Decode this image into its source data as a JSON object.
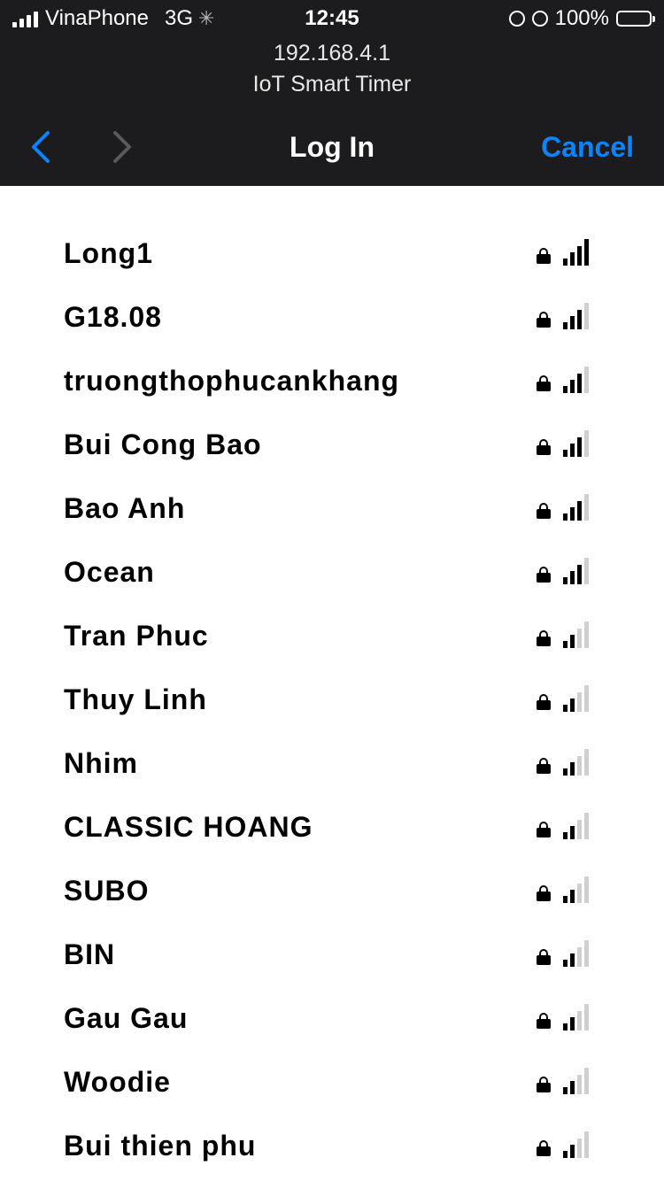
{
  "status_bar": {
    "carrier": "VinaPhone",
    "network": "3G",
    "time": "12:45",
    "battery": "100%",
    "battery_color": "#ffd60a"
  },
  "header": {
    "url": "192.168.4.1",
    "page_title": "IoT Smart Timer",
    "title": "Log In",
    "cancel_label": "Cancel",
    "accent_color": "#0a84ff"
  },
  "networks": [
    {
      "ssid": "Long1",
      "secured": true,
      "signal": 4
    },
    {
      "ssid": "G18.08",
      "secured": true,
      "signal": 3
    },
    {
      "ssid": "truongthophucankhang",
      "secured": true,
      "signal": 3
    },
    {
      "ssid": "Bui Cong Bao",
      "secured": true,
      "signal": 3
    },
    {
      "ssid": "Bao Anh",
      "secured": true,
      "signal": 3
    },
    {
      "ssid": "Ocean",
      "secured": true,
      "signal": 3
    },
    {
      "ssid": "Tran Phuc",
      "secured": true,
      "signal": 2
    },
    {
      "ssid": "Thuy Linh",
      "secured": true,
      "signal": 2
    },
    {
      "ssid": "Nhim",
      "secured": true,
      "signal": 2
    },
    {
      "ssid": "CLASSIC HOANG",
      "secured": true,
      "signal": 2
    },
    {
      "ssid": "SUBO",
      "secured": true,
      "signal": 2
    },
    {
      "ssid": "BIN",
      "secured": true,
      "signal": 2
    },
    {
      "ssid": "Gau Gau",
      "secured": true,
      "signal": 2
    },
    {
      "ssid": "Woodie",
      "secured": true,
      "signal": 2
    },
    {
      "ssid": "Bui thien phu",
      "secured": true,
      "signal": 2
    }
  ]
}
